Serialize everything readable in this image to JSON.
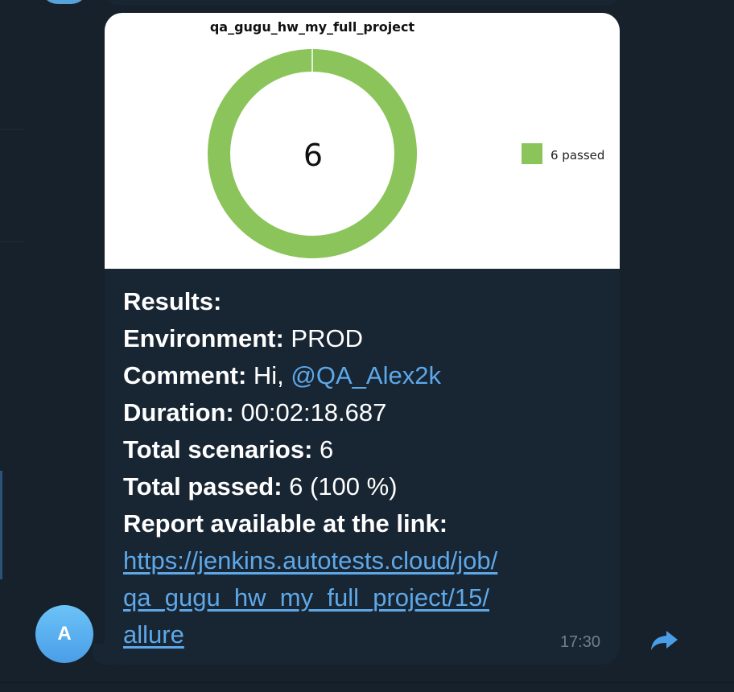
{
  "message": {
    "chart_image": {
      "chart_data": {
        "type": "pie",
        "title": "qa_gugu_hw_my_full_project",
        "center_label": "6",
        "slices": [
          {
            "label": "6 passed",
            "value": 6,
            "color": "#8bc45a"
          }
        ],
        "legend": [
          "6 passed"
        ],
        "legend_position": "right"
      }
    },
    "lines": {
      "results_label": "Results:",
      "environment_label": "Environment:",
      "environment_value": " PROD",
      "comment_label": "Comment:",
      "comment_value": " Hi, ",
      "comment_mention": "@QA_Alex2k",
      "duration_label": "Duration:",
      "duration_value": " 00:02:18.687",
      "total_scenarios_label": "Total scenarios:",
      "total_scenarios_value": " 6",
      "total_passed_label": "Total passed:",
      "total_passed_value": " 6 (100 %)",
      "report_label": "Report available at the link:"
    },
    "link_lines": [
      "https://jenkins.autotests.cloud/job/",
      "qa_gugu_hw_my_full_project/15/",
      "allure"
    ],
    "time": "17:30"
  },
  "sender": {
    "avatar_letter": "A"
  },
  "colors": {
    "background": "#17212b",
    "bubble": "#182533",
    "link": "#5ea8e8",
    "passed": "#8bc45a"
  },
  "icons": {
    "forward": "forward-arrow-icon"
  }
}
